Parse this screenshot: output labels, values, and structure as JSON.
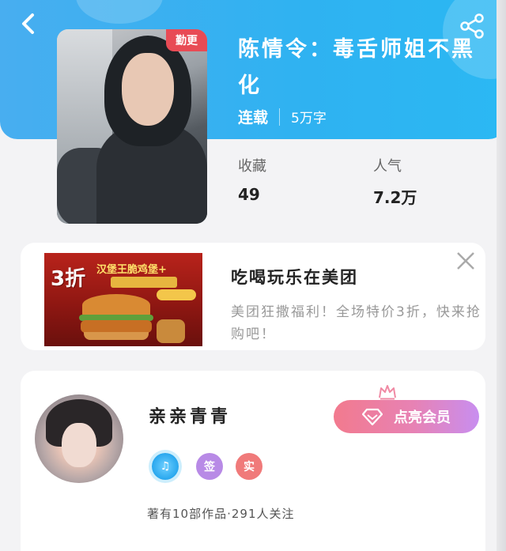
{
  "book": {
    "title": "陈情令：毒舌师姐不黑化",
    "status": "连载",
    "word_count": "5万字",
    "badge": "勤更",
    "favorites_label": "收藏",
    "favorites_value": "49",
    "popularity_label": "人气",
    "popularity_value": "7.2万"
  },
  "ad": {
    "title": "吃喝玩乐在美团",
    "description": "美团狂撒福利！全场特价3折，快来抢购吧！",
    "image_discount": "3折",
    "image_promo": "汉堡王脆鸡堡+"
  },
  "author": {
    "name": "亲亲青青",
    "vip_button": "点亮会员",
    "badges": [
      "♫",
      "签",
      "实"
    ],
    "stats": "著有10部作品·291人关注"
  },
  "colors": {
    "header": "#2fb2f1",
    "vip_gradient_start": "#f27a8e",
    "vip_gradient_end": "#c88ef0"
  },
  "icons": {
    "back": "back-arrow-icon",
    "share": "share-icon",
    "close": "close-icon",
    "crown": "crown-icon",
    "gem": "gem-icon"
  }
}
